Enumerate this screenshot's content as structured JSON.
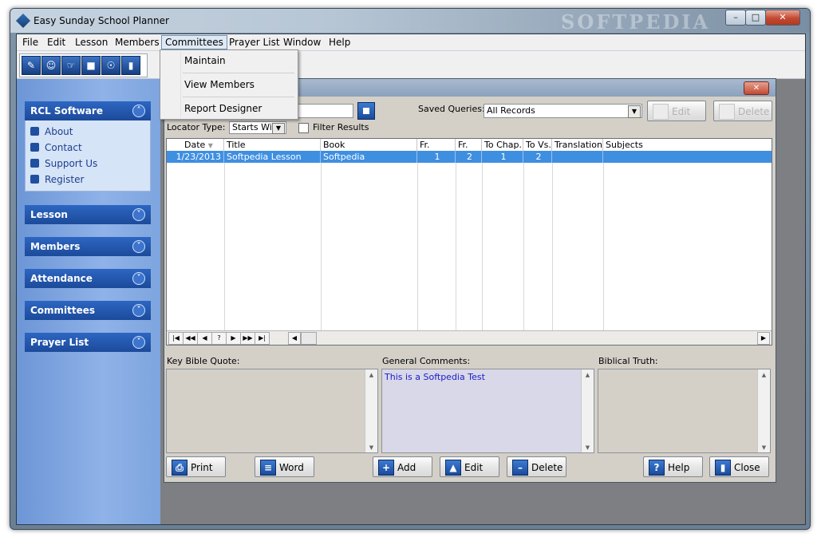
{
  "window": {
    "title": "Easy Sunday School Planner",
    "watermark": "SOFTPEDIA",
    "minimize_glyph": "–",
    "maximize_glyph": "□",
    "close_glyph": "✕"
  },
  "menu": {
    "items": [
      "File",
      "Edit",
      "Lesson",
      "Members",
      "Committees",
      "Prayer List",
      "Window",
      "Help"
    ],
    "open_index": 4,
    "dropdown": [
      "Maintain",
      "View Members",
      "Report Designer"
    ]
  },
  "toolbar": {
    "icons": [
      "lesson-tool-icon",
      "member-tool-icon",
      "prayer-tool-icon",
      "attendance-tool-icon",
      "committee-tool-icon",
      "exit-door-icon"
    ]
  },
  "sidebar": {
    "panels": [
      {
        "title": "RCL Software",
        "expanded": true,
        "links": [
          "About",
          "Contact",
          "Support Us",
          "Register"
        ]
      },
      {
        "title": "Lesson",
        "expanded": false
      },
      {
        "title": "Members",
        "expanded": false
      },
      {
        "title": "Attendance",
        "expanded": false
      },
      {
        "title": "Committees",
        "expanded": false
      },
      {
        "title": "Prayer List",
        "expanded": false
      }
    ]
  },
  "child_window": {
    "close_glyph": "✕",
    "saved_queries_label": "Saved Queries:",
    "saved_queries_value": "All Records",
    "edit_button": "Edit",
    "delete_button": "Delete",
    "locator_label": "Locator Type:",
    "locator_value": "Starts With",
    "filter_label": "Filter Results",
    "grid": {
      "columns": [
        "Date",
        "Title",
        "Book",
        "Fr. Chap.",
        "Fr. Vs.",
        "To Chap.",
        "To Vs.",
        "Translation",
        "Subjects"
      ],
      "rows": [
        [
          "1/23/2013",
          "Softpedia Lesson",
          "Softpedia",
          "1",
          "2",
          "1",
          "2",
          "",
          ""
        ]
      ]
    },
    "nav_buttons": [
      "|◀",
      "◀◀",
      "◀",
      "?",
      "▶",
      "▶▶",
      "▶|"
    ],
    "key_bible_quote_label": "Key Bible Quote:",
    "general_comments_label": "General Comments:",
    "general_comments_text": "This is a Softpedia Test",
    "biblical_truth_label": "Biblical Truth:",
    "buttons": {
      "print": "Print",
      "word": "Word",
      "add": "Add",
      "edit": "Edit",
      "delete": "Delete",
      "help": "Help",
      "close": "Close"
    }
  },
  "colors": {
    "sidebar_header": "#1c4a9a",
    "selected_row": "#3f8fe1",
    "comment_text": "#1a1acb"
  }
}
